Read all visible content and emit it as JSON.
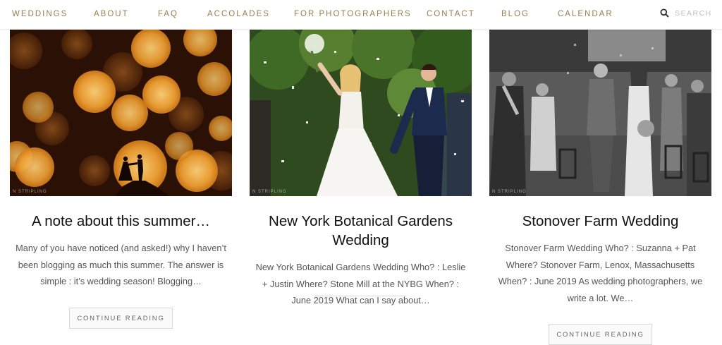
{
  "nav": {
    "items": [
      "WEDDINGS",
      "ABOUT",
      "FAQ",
      "ACCOLADES",
      "FOR PHOTOGRAPHERS",
      "CONTACT",
      "BLOG",
      "CALENDAR"
    ],
    "search_placeholder": "SEARCH",
    "search_icon": "search-icon"
  },
  "posts": [
    {
      "title": "A note about this summer…",
      "excerpt": "Many of you have noticed (and asked!) why I haven’t been blogging as much this summer. The answer is simple : it’s wedding season! Blogging…",
      "button": "CONTINUE READING",
      "watermark": "N STRIPLING"
    },
    {
      "title": "New York Botanical Gardens Wedding",
      "excerpt": "New York Botanical Gardens Wedding Who? : Leslie + Justin Where?  Stone Mill at the NYBG When? : June 2019 What can I say about…",
      "button": "",
      "watermark": "N STRIPLING"
    },
    {
      "title": "Stonover Farm Wedding",
      "excerpt": "Stonover Farm Wedding Who? : Suzanna + Pat Where? Stonover Farm, Lenox, Massachusetts When? : June 2019 As wedding photographers, we write a lot.  We…",
      "button": "CONTINUE READING",
      "watermark": "N STRIPLING"
    }
  ],
  "colors": {
    "nav_text": "#9a7d4e",
    "title": "#111111",
    "excerpt": "#555555"
  }
}
